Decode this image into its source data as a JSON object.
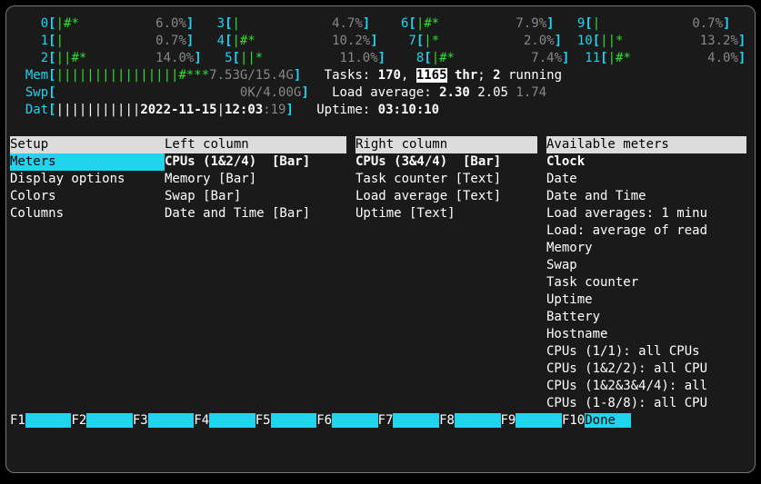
{
  "cpus": [
    {
      "id": "0",
      "bar": "|#*          ",
      "pct": "6.0%"
    },
    {
      "id": "1",
      "bar": "|            ",
      "pct": "0.7%"
    },
    {
      "id": "2",
      "bar": "||#*         ",
      "pct": "14.0%"
    },
    {
      "id": "3",
      "bar": "|            ",
      "pct": "4.7%"
    },
    {
      "id": "4",
      "bar": "|#*          ",
      "pct": "10.2%"
    },
    {
      "id": "5",
      "bar": "||*          ",
      "pct": "11.0%"
    },
    {
      "id": "6",
      "bar": "|#*          ",
      "pct": "7.9%"
    },
    {
      "id": "7",
      "bar": "|*           ",
      "pct": "2.0%"
    },
    {
      "id": "8",
      "bar": "|#*          ",
      "pct": "7.4%"
    },
    {
      "id": "9",
      "bar": "|            ",
      "pct": "0.7%"
    },
    {
      "id": "10",
      "bar": "||*          ",
      "pct": "13.2%"
    },
    {
      "id": "11",
      "bar": "|#*          ",
      "pct": "4.0%"
    }
  ],
  "mem": {
    "label": "Mem",
    "bar": "||||||||||||||||#***",
    "used": "7.53G",
    "total": "15.4G"
  },
  "swp": {
    "label": "Swp",
    "used": "0K",
    "total": "4.00G"
  },
  "dat": {
    "label": "Dat",
    "bar": "|||||||||||",
    "date": "2022-11-15",
    "time": "12:03",
    "sec": ":19"
  },
  "tasks": {
    "label": "Tasks: ",
    "procs": "170",
    "threads": "1165",
    "thr_label": " thr",
    "running": "2",
    "running_label": " running"
  },
  "load": {
    "label": "Load average: ",
    "l1": "2.30",
    "l5": "2.05",
    "l15": "1.74"
  },
  "uptime": {
    "label": "Uptime: ",
    "value": "03:10:10"
  },
  "setup_menu": {
    "title": "Setup",
    "items": [
      "Meters",
      "Display options",
      "Colors",
      "Columns"
    ],
    "selected_index": 0
  },
  "left_column": {
    "title": "Left column",
    "items": [
      "CPUs (1&2/4)  [Bar]",
      "Memory [Bar]",
      "Swap [Bar]",
      "Date and Time [Bar]"
    ],
    "selected_index": 0
  },
  "right_column": {
    "title": "Right column",
    "items": [
      "CPUs (3&4/4)  [Bar]",
      "Task counter [Text]",
      "Load average [Text]",
      "Uptime [Text]"
    ],
    "selected_index": 0
  },
  "available_meters": {
    "title": "Available meters",
    "items": [
      "Clock",
      "Date",
      "Date and Time",
      "Load averages: 1 minu",
      "Load: average of read",
      "Memory",
      "Swap",
      "Task counter",
      "Uptime",
      "Battery",
      "Hostname",
      "CPUs (1/1): all CPUs",
      "CPUs (1&2/2): all CPU",
      "CPUs (1&2&3&4/4): all",
      "CPUs (1-8/8): all CPU"
    ],
    "selected_index": 0
  },
  "fkeys": [
    {
      "key": "F1",
      "label": "      "
    },
    {
      "key": "F2",
      "label": "      "
    },
    {
      "key": "F3",
      "label": "      "
    },
    {
      "key": "F4",
      "label": "      "
    },
    {
      "key": "F5",
      "label": "      "
    },
    {
      "key": "F6",
      "label": "      "
    },
    {
      "key": "F7",
      "label": "      "
    },
    {
      "key": "F8",
      "label": "      "
    },
    {
      "key": "F9",
      "label": "      "
    },
    {
      "key": "F10",
      "label": "Done  "
    }
  ]
}
